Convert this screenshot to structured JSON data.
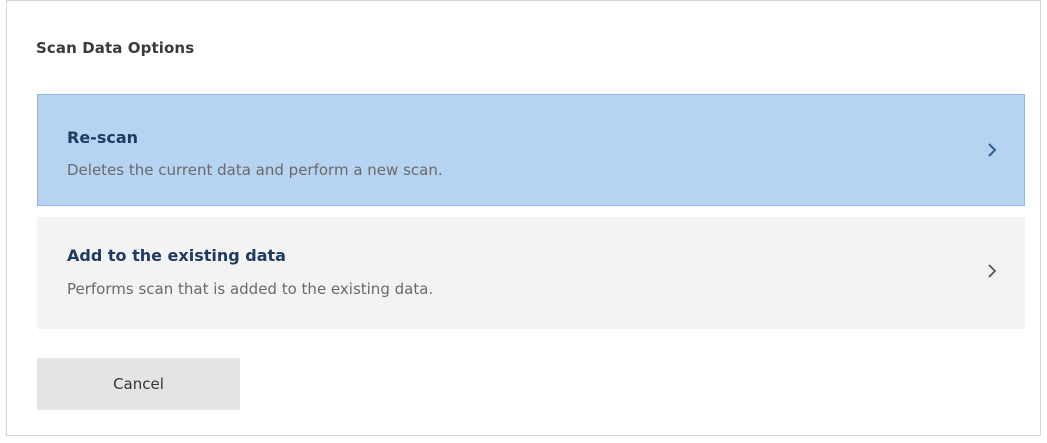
{
  "dialog": {
    "title": "Scan Data Options",
    "options": [
      {
        "title": "Re-scan",
        "description": "Deletes the current data and perform a new scan.",
        "icon": "chevron-right-icon",
        "selected": true
      },
      {
        "title": "Add to the existing data",
        "description": "Performs scan that is added to the existing data.",
        "icon": "chevron-right-icon",
        "selected": false
      }
    ],
    "cancel_label": "Cancel"
  },
  "colors": {
    "selected_bg": "#b7d3f2",
    "selected_border": "#8eb6e3",
    "option_bg": "#f3f3f3",
    "title_text": "#1f3b63",
    "cancel_bg": "#e4e4e4"
  }
}
